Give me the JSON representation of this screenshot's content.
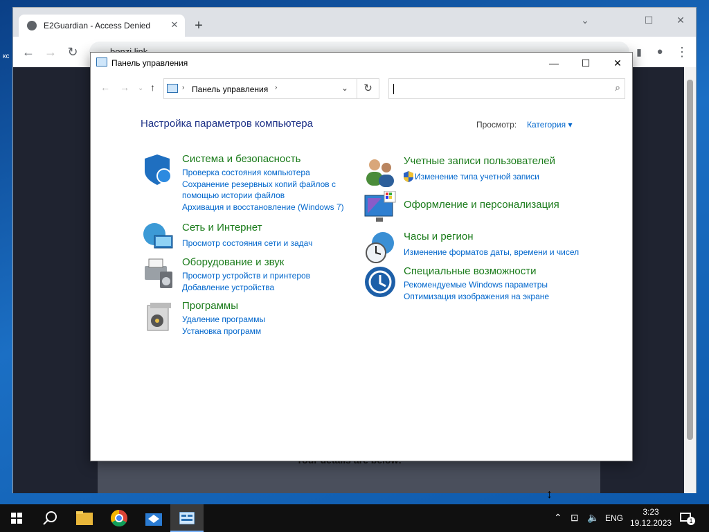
{
  "desktop": {
    "label": "кс"
  },
  "browser": {
    "tab_title": "E2Guardian - Access Denied",
    "tab_close": "✕",
    "new_tab": "+",
    "url": "bonzi.link",
    "details_text": "Your details are below:"
  },
  "cp": {
    "title": "Панель управления",
    "address": "Панель управления",
    "search_placeholder": "",
    "heading": "Настройка параметров компьютера",
    "view_label": "Просмотр:",
    "view_value": "Категория",
    "categories": [
      {
        "title": "Система и безопасность",
        "links": [
          "Проверка состояния компьютера",
          "Сохранение резервных копий файлов с",
          "помощью истории файлов",
          "Архивация и восстановление (Windows 7)"
        ],
        "icon": "shield-icon"
      },
      {
        "title": "Сеть и Интернет",
        "links": [
          "Просмотр состояния сети и задач"
        ],
        "icon": "network-icon"
      },
      {
        "title": "Оборудование и звук",
        "links": [
          "Просмотр устройств и принтеров",
          "Добавление устройства"
        ],
        "icon": "printer-icon"
      },
      {
        "title": "Программы",
        "links": [
          "Удаление программы",
          "Установка программ"
        ],
        "icon": "programs-icon"
      },
      {
        "title": "Учетные записи пользователей",
        "links": [
          "Изменение типа учетной записи"
        ],
        "icon": "users-icon"
      },
      {
        "title": "Оформление и персонализация",
        "links": [],
        "icon": "display-icon"
      },
      {
        "title": "Часы и регион",
        "links": [
          "Изменение форматов даты, времени и чисел"
        ],
        "icon": "clock-globe-icon"
      },
      {
        "title": "Специальные возможности",
        "links": [
          "Рекомендуемые Windows параметры",
          "Оптимизация изображения на экране"
        ],
        "icon": "accessibility-icon"
      }
    ]
  },
  "taskbar": {
    "lang": "ENG",
    "time": "3:23",
    "date": "19.12.2023",
    "notif_count": "1"
  }
}
